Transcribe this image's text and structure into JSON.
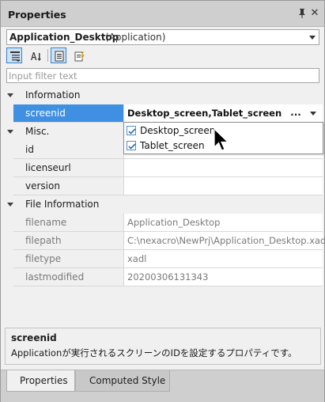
{
  "window": {
    "title": "Properties"
  },
  "object_selector": {
    "name": "Application_Desktop",
    "type": "(Application)"
  },
  "toolbar": {
    "buttons": [
      "categorized-view",
      "alphabetical-view",
      "properties-view",
      "events-view"
    ]
  },
  "filter": {
    "placeholder": "Input filter text",
    "value": ""
  },
  "grid": {
    "categories": [
      {
        "label": "Information"
      },
      {
        "label": "Misc."
      },
      {
        "label": "File Information"
      }
    ],
    "screenid": {
      "name": "screenid",
      "value": "Desktop_screen,Tablet_screen"
    },
    "misc": [
      {
        "name": "id",
        "value": ""
      },
      {
        "name": "licenseurl",
        "value": ""
      },
      {
        "name": "version",
        "value": ""
      }
    ],
    "file_info": [
      {
        "name": "filename",
        "value": "Application_Desktop"
      },
      {
        "name": "filepath",
        "value": "C:\\nexacro\\NewPrj\\Application_Desktop.xadl"
      },
      {
        "name": "filetype",
        "value": "xadl"
      },
      {
        "name": "lastmodified",
        "value": "20200306131343"
      }
    ],
    "ellipsis_label": "..."
  },
  "dropdown": {
    "options": [
      {
        "label": "Desktop_screen",
        "checked": true
      },
      {
        "label": "Tablet_screen",
        "checked": true
      }
    ]
  },
  "description": {
    "title": "screenid",
    "text": "Applicationが実行されるスクリーンのIDを設定するプロパティです。"
  },
  "tabs": [
    {
      "label": "Properties",
      "active": true
    },
    {
      "label": "Computed Style",
      "active": false
    }
  ],
  "colors": {
    "selection": "#3f90e3",
    "panel": "#f0f0f0",
    "titlebar": "#cfcfcf",
    "active_button": "#cde3f7"
  }
}
